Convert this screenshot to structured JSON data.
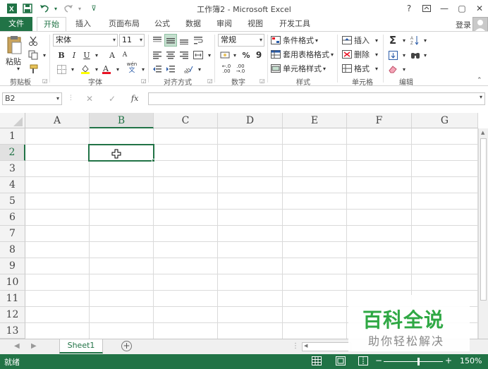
{
  "window": {
    "title": "工作簿2 - Microsoft Excel",
    "help": "?",
    "minimize": "—",
    "restore": "▢",
    "close": "✕"
  },
  "quick_access": {
    "save_icon": "save-icon",
    "undo_icon": "undo-icon",
    "redo_icon": "redo-icon"
  },
  "tabs": [
    {
      "label": "文件"
    },
    {
      "label": "开始"
    },
    {
      "label": "插入"
    },
    {
      "label": "页面布局"
    },
    {
      "label": "公式"
    },
    {
      "label": "数据"
    },
    {
      "label": "审阅"
    },
    {
      "label": "视图"
    },
    {
      "label": "开发工具"
    }
  ],
  "account": {
    "login": "登录"
  },
  "ribbon": {
    "clipboard": {
      "label": "剪贴板",
      "paste": "粘贴"
    },
    "font": {
      "label": "字体",
      "name": "宋体",
      "size": "11",
      "bold": "B",
      "italic": "I",
      "underline": "U",
      "grow": "A",
      "shrink": "A",
      "phonetic_top": "wén",
      "phonetic_bottom": "文"
    },
    "alignment": {
      "label": "对齐方式"
    },
    "number": {
      "label": "数字",
      "format": "常规",
      "percent": "%",
      "comma": "9",
      "inc_decimal": "←.0 .00",
      "dec_decimal": ".00 →.0"
    },
    "styles": {
      "label": "样式",
      "conditional": "条件格式",
      "table": "套用表格格式",
      "cell_styles": "单元格样式"
    },
    "cells": {
      "label": "单元格",
      "insert": "插入",
      "delete": "删除",
      "format": "格式"
    },
    "editing": {
      "label": "编辑",
      "sum": "Σ"
    }
  },
  "formula_bar": {
    "name_box": "B2",
    "cancel": "✕",
    "enter": "✓",
    "fx": "fx",
    "value": ""
  },
  "grid": {
    "columns": [
      "A",
      "B",
      "C",
      "D",
      "E",
      "F",
      "G"
    ],
    "rows": [
      "1",
      "2",
      "3",
      "4",
      "5",
      "6",
      "7",
      "8",
      "9",
      "10",
      "11",
      "12",
      "13"
    ],
    "selected_cell": "B2"
  },
  "sheets": {
    "tabs": [
      "Sheet1"
    ],
    "add": "+"
  },
  "status": {
    "ready": "就绪",
    "zoom": "150%"
  },
  "watermark": {
    "line1": "百科全说",
    "line2": "助你轻松解决"
  }
}
